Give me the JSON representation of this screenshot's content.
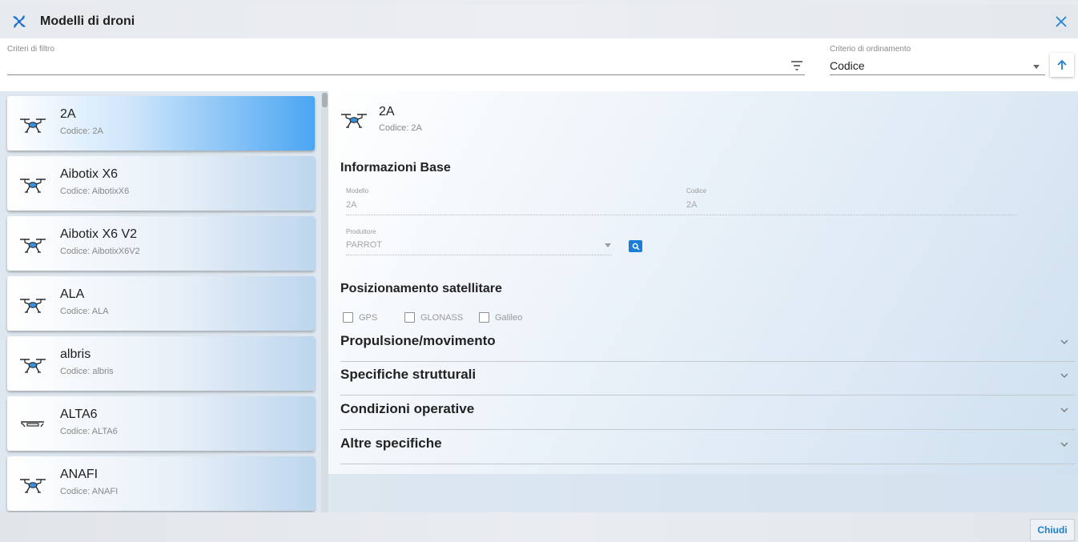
{
  "window": {
    "title": "Modelli di droni",
    "app_icon": "drone-fan-icon",
    "close_icon": "close-icon"
  },
  "filter": {
    "label": "Criteri di filtro",
    "value": "",
    "icon": "filter-icon"
  },
  "sort": {
    "label": "Criterio di ordinamento",
    "value": "Codice",
    "direction_icon": "arrow-up-icon"
  },
  "list": {
    "items": [
      {
        "name": "2A",
        "code": "Codice: 2A",
        "icon": "drone-icon",
        "selected": true
      },
      {
        "name": "Aibotix X6",
        "code": "Codice: AibotixX6",
        "icon": "drone-icon",
        "selected": false
      },
      {
        "name": "Aibotix X6 V2",
        "code": "Codice: AibotixX6V2",
        "icon": "drone-icon",
        "selected": false
      },
      {
        "name": "ALA",
        "code": "Codice: ALA",
        "icon": "drone-icon",
        "selected": false
      },
      {
        "name": "albris",
        "code": "Codice: albris",
        "icon": "drone-icon",
        "selected": false
      },
      {
        "name": "ALTA6",
        "code": "Codice: ALTA6",
        "icon": "multirotor-frame-icon",
        "selected": false
      },
      {
        "name": "ANAFI",
        "code": "Codice: ANAFI",
        "icon": "drone-icon",
        "selected": false
      }
    ]
  },
  "detail": {
    "name": "2A",
    "code": "Codice: 2A",
    "info_base": {
      "title": "Informazioni Base",
      "modello_label": "Modello",
      "modello_value": "2A",
      "codice_label": "Codice",
      "codice_value": "2A",
      "produttore_label": "Produttore",
      "produttore_value": "PARROT"
    },
    "satellite": {
      "title": "Posizionamento satellitare",
      "options": [
        "GPS",
        "GLONASS",
        "Galileo"
      ]
    },
    "sections": [
      "Propulsione/movimento",
      "Specifiche strutturali",
      "Condizioni operative",
      "Altre specifiche"
    ]
  },
  "footer": {
    "close_label": "Chiudi"
  },
  "colors": {
    "accent": "#1a7ed6",
    "selected_card": "#4aa6f2"
  }
}
